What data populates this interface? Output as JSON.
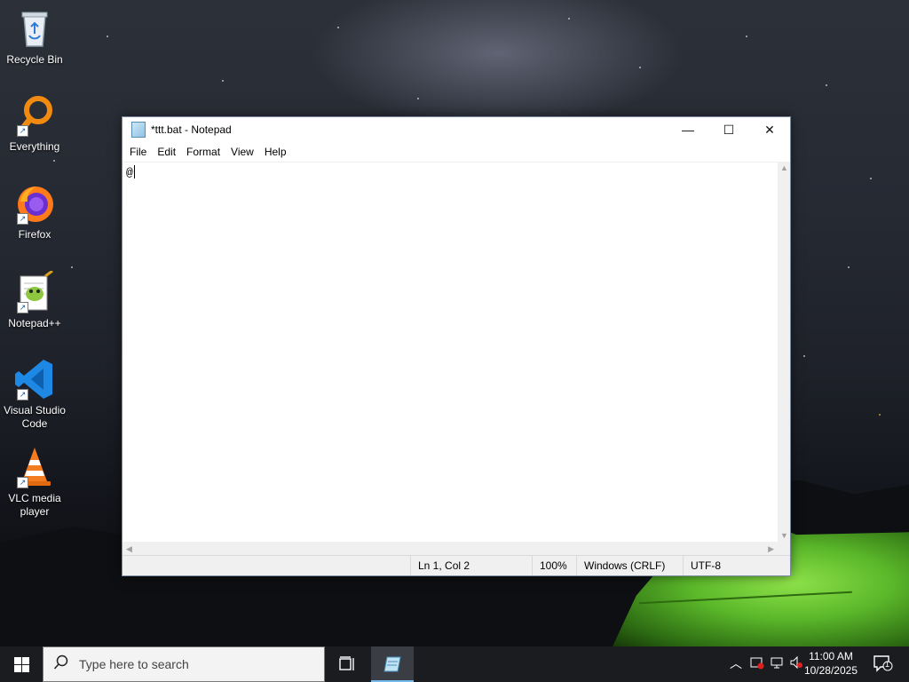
{
  "desktop": {
    "icons": [
      {
        "label": "Recycle Bin",
        "icon": "recycle-bin-icon"
      },
      {
        "label": "Everything",
        "icon": "everything-icon"
      },
      {
        "label": "Firefox",
        "icon": "firefox-icon"
      },
      {
        "label": "Notepad++",
        "icon": "notepad-plus-plus-icon"
      },
      {
        "label": "Visual Studio Code",
        "icon": "vscode-icon"
      },
      {
        "label": "VLC media player",
        "icon": "vlc-icon"
      }
    ]
  },
  "notepad": {
    "title": "*ttt.bat - Notepad",
    "menu": [
      "File",
      "Edit",
      "Format",
      "View",
      "Help"
    ],
    "content": "@",
    "status": {
      "position": "Ln 1, Col 2",
      "zoom": "100%",
      "line_ending": "Windows (CRLF)",
      "encoding": "UTF-8"
    },
    "buttons": {
      "minimize": "—",
      "maximize": "☐",
      "close": "✕"
    }
  },
  "taskbar": {
    "search_placeholder": "Type here to search",
    "time": "11:00 AM",
    "date": "10/28/2025",
    "notification_count": "1"
  },
  "colors": {
    "taskbar_bg": "#1b1c20",
    "accent": "#76b9ed",
    "tent_green": "#5bb82a"
  }
}
